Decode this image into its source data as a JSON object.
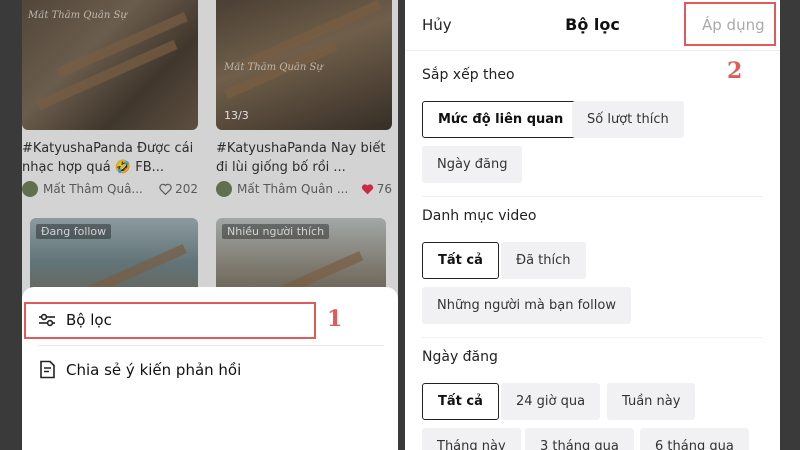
{
  "feed": {
    "videos": [
      {
        "watermark": "Mất Thâm Quân Sự",
        "caption": "#KatyushaPanda Được cái nhạc hợp quá 🤣 FB...",
        "author": "Mất Thâm Quâ...",
        "likes": "202",
        "liked": false
      },
      {
        "watermark": "Mất Thâm Quân Sự",
        "counter": "13/3",
        "caption": "#KatyushaPanda Nay biết đi lùi giống bố rồi ...",
        "author": "Mất Thâm Quân ...",
        "likes": "76",
        "liked": true
      },
      {
        "tag": "Đang follow"
      },
      {
        "tag": "Nhiều người thích"
      }
    ]
  },
  "bottom_sheet": {
    "filter_label": "Bộ lọc",
    "feedback_label": "Chia sẻ ý kiến phản hồi"
  },
  "annotations": {
    "step1": "1",
    "step2": "2"
  },
  "filter_panel": {
    "cancel": "Hủy",
    "title": "Bộ lọc",
    "apply": "Áp dụng",
    "sort": {
      "heading": "Sắp xếp theo",
      "options": [
        "Mức độ liên quan",
        "Số lượt thích",
        "Ngày đăng"
      ],
      "selected": "Mức độ liên quan"
    },
    "category": {
      "heading": "Danh mục video",
      "options": [
        "Tất cả",
        "Đã thích",
        "Những người mà bạn follow"
      ],
      "selected": "Tất cả"
    },
    "date": {
      "heading": "Ngày đăng",
      "options": [
        "Tất cả",
        "24 giờ qua",
        "Tuần này",
        "Tháng này",
        "3 tháng qua",
        "6 tháng qua"
      ],
      "selected": "Tất cả"
    }
  },
  "colors": {
    "highlight": "#e05a5a",
    "like_red": "#e8304a"
  }
}
